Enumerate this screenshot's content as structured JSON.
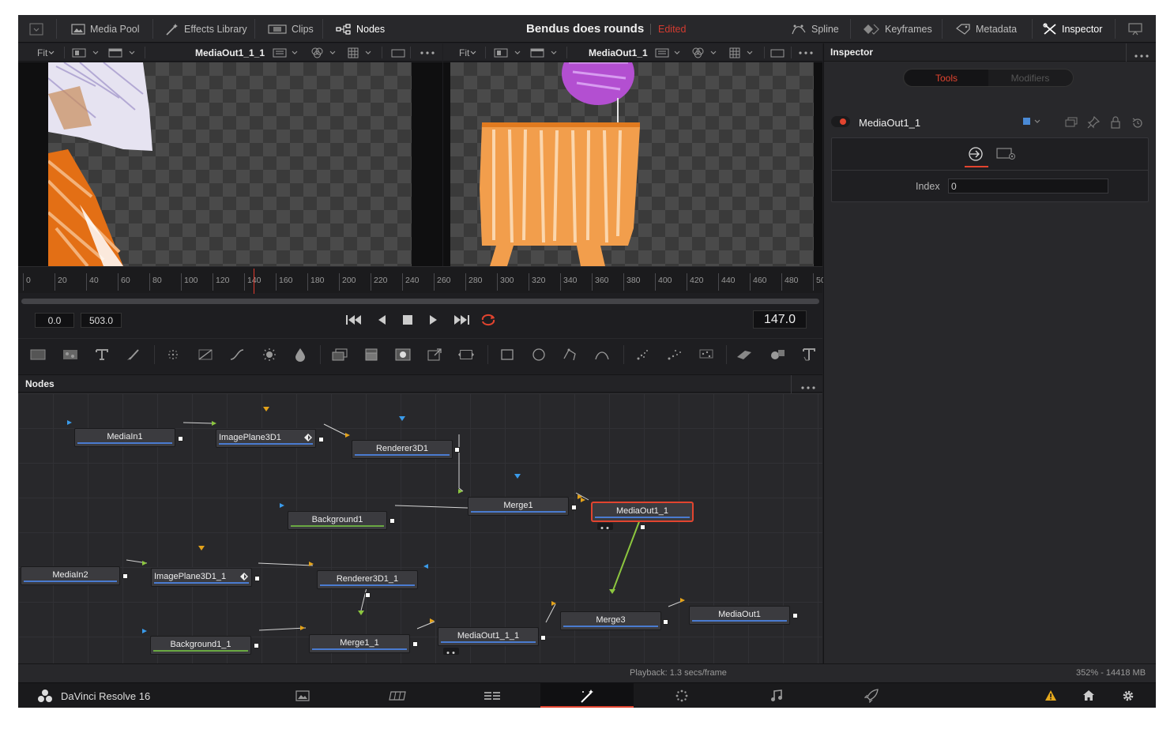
{
  "topbar": {
    "items": [
      {
        "label": "Media Pool",
        "icon": "media-pool-icon"
      },
      {
        "label": "Effects Library",
        "icon": "effects-wand-icon"
      },
      {
        "label": "Clips",
        "icon": "clips-icon"
      },
      {
        "label": "Nodes",
        "icon": "nodes-icon"
      }
    ],
    "project_title": "Bendus does rounds",
    "project_status": "Edited",
    "right_items": [
      {
        "label": "Spline",
        "icon": "spline-icon"
      },
      {
        "label": "Keyframes",
        "icon": "keyframes-icon"
      },
      {
        "label": "Metadata",
        "icon": "metadata-icon"
      },
      {
        "label": "Inspector",
        "icon": "inspector-icon"
      }
    ]
  },
  "viewer_left": {
    "fit_label": "Fit",
    "title": "MediaOut1_1_1"
  },
  "viewer_right": {
    "fit_label": "Fit",
    "title": "MediaOut1_1"
  },
  "ruler": {
    "ticks": [
      "0",
      "20",
      "40",
      "60",
      "80",
      "100",
      "120",
      "140",
      "160",
      "180",
      "200",
      "220",
      "240",
      "260",
      "280",
      "300",
      "320",
      "340",
      "360",
      "380",
      "400",
      "420",
      "440",
      "460",
      "480",
      "50"
    ],
    "playhead_frame": 147
  },
  "transport": {
    "start": "0.0",
    "end": "503.0",
    "current": "147.0"
  },
  "nodes_panel": {
    "title": "Nodes"
  },
  "nodes": [
    {
      "id": "MediaIn1",
      "label": "MediaIn1"
    },
    {
      "id": "ImagePlane3D1",
      "label": "ImagePlane3D1"
    },
    {
      "id": "Renderer3D1",
      "label": "Renderer3D1"
    },
    {
      "id": "Merge1",
      "label": "Merge1"
    },
    {
      "id": "Background1",
      "label": "Background1"
    },
    {
      "id": "MediaOut1_1",
      "label": "MediaOut1_1"
    },
    {
      "id": "MediaIn2",
      "label": "MediaIn2"
    },
    {
      "id": "ImagePlane3D1_1",
      "label": "ImagePlane3D1_1"
    },
    {
      "id": "Renderer3D1_1",
      "label": "Renderer3D1_1"
    },
    {
      "id": "Background1_1",
      "label": "Background1_1"
    },
    {
      "id": "Merge1_1",
      "label": "Merge1_1"
    },
    {
      "id": "MediaOut1_1_1",
      "label": "MediaOut1_1_1"
    },
    {
      "id": "Merge3",
      "label": "Merge3"
    },
    {
      "id": "MediaOut1",
      "label": "MediaOut1"
    }
  ],
  "inspector": {
    "header": "Inspector",
    "tabs": [
      "Tools",
      "Modifiers"
    ],
    "active_tab": "Tools",
    "tool_name": "MediaOut1_1",
    "index_label": "Index",
    "index_value": "0"
  },
  "status": {
    "playback": "Playback: 1.3 secs/frame",
    "memory": "352% - 14418 MB"
  },
  "bottom": {
    "app_name": "DaVinci Resolve 16",
    "active_page": "fusion"
  },
  "colors": {
    "accent_red": "#e2442f",
    "edited_red": "#d33b30",
    "connection_green": "#8cc63f"
  }
}
